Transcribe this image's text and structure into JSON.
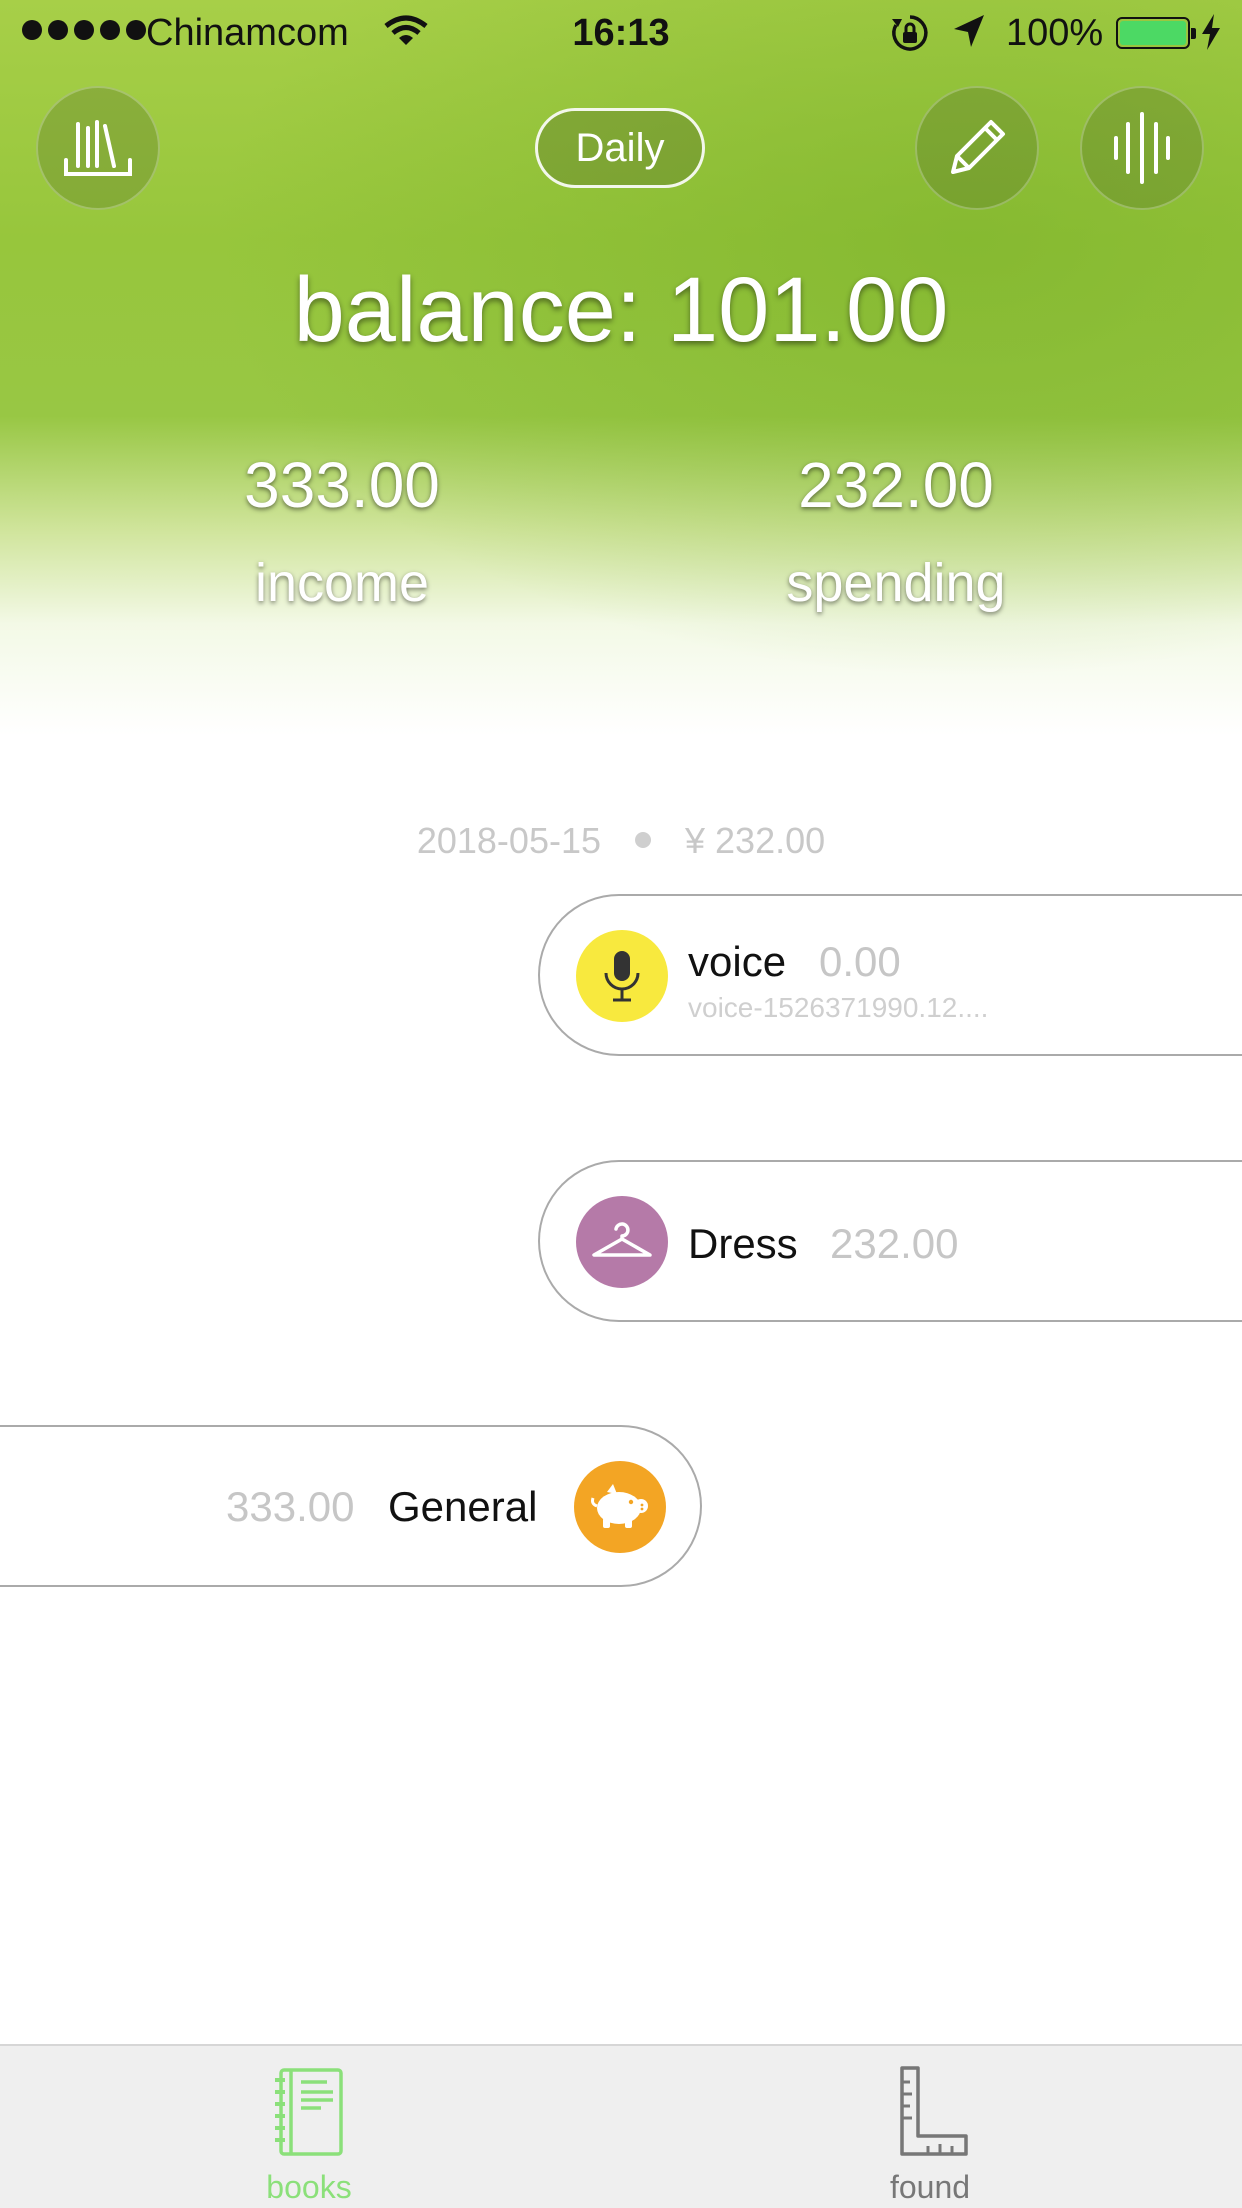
{
  "status_bar": {
    "carrier": "Chinamcom",
    "time": "16:13",
    "battery_pct": "100%",
    "battery_color": "#4cd964"
  },
  "header": {
    "view_mode": "Daily",
    "balance_text": "balance: 101.00",
    "income_value": "333.00",
    "income_label": "income",
    "spending_value": "232.00",
    "spending_label": "spending",
    "buttons": [
      "books-shelf-icon",
      "pencil-icon",
      "soundwave-icon"
    ]
  },
  "day": {
    "date": "2018-05-15",
    "total": "¥ 232.00"
  },
  "records": [
    {
      "name": "voice",
      "amount": "0.00",
      "note": "voice-1526371990.12....",
      "icon": "microphone-icon",
      "color": "#f8e93e",
      "side": "spending"
    },
    {
      "name": "Dress",
      "amount": "232.00",
      "icon": "hanger-icon",
      "color": "#b57aa8",
      "side": "spending"
    },
    {
      "name": "General",
      "amount": "333.00",
      "icon": "piggy-bank-icon",
      "color": "#f3a524",
      "side": "income"
    }
  ],
  "tabs": [
    {
      "label": "books",
      "icon": "notebook-icon",
      "color": "#8be07a",
      "active": true
    },
    {
      "label": "found",
      "icon": "ruler-icon",
      "color": "#777777",
      "active": false
    }
  ]
}
